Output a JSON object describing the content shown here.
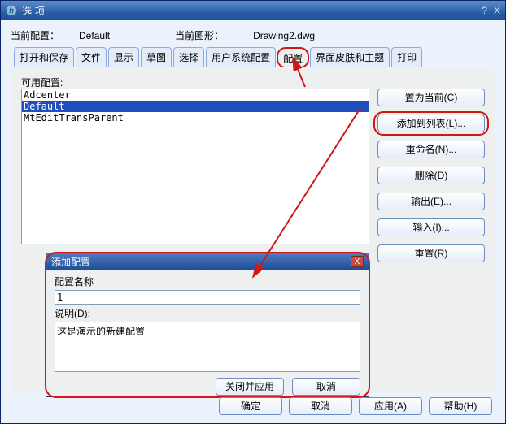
{
  "window": {
    "title": "选项"
  },
  "header": {
    "current_config_label": "当前配置：",
    "current_config_value": "Default",
    "current_drawing_label": "当前图形：",
    "current_drawing_value": "Drawing2.dwg"
  },
  "tabs": [
    {
      "label": "打开和保存"
    },
    {
      "label": "文件"
    },
    {
      "label": "显示"
    },
    {
      "label": "草图"
    },
    {
      "label": "选择"
    },
    {
      "label": "用户系统配置"
    },
    {
      "label": "配置"
    },
    {
      "label": "界面皮肤和主题"
    },
    {
      "label": "打印"
    }
  ],
  "profiles": {
    "available_label": "可用配置:",
    "items": [
      "Adcenter",
      "Default",
      "MtEditTransParent"
    ],
    "selected_index": 1,
    "buttons": {
      "set_current": "置为当前(C)",
      "add_to_list": "添加到列表(L)...",
      "rename": "重命名(N)...",
      "delete": "删除(D)",
      "export": "输出(E)...",
      "import": "输入(I)...",
      "reset": "重置(R)"
    }
  },
  "modal": {
    "title": "添加配置",
    "name_label": "配置名称",
    "name_value": "1",
    "desc_label": "说明(D):",
    "desc_value": "这是演示的新建配置",
    "close_apply": "关闭并应用",
    "cancel": "取消"
  },
  "footer": {
    "ok": "确定",
    "cancel": "取消",
    "apply": "应用(A)",
    "help": "帮助(H)"
  }
}
